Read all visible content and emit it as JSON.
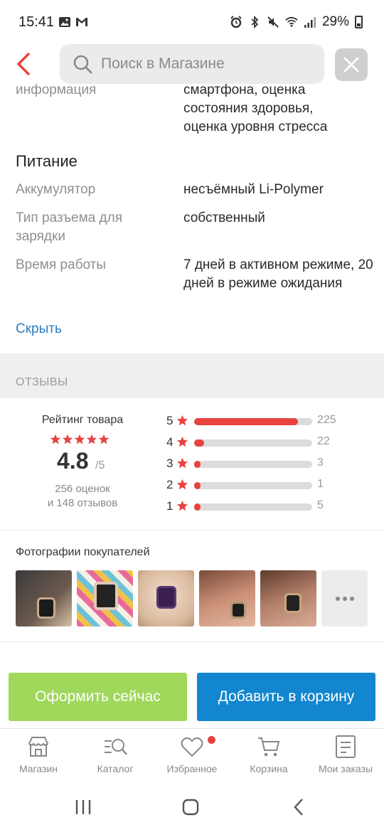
{
  "status_bar": {
    "time": "15:41",
    "battery": "29%",
    "left_icons": [
      "image-icon",
      "gmail-icon"
    ],
    "right_icons": [
      "alarm-icon",
      "bluetooth-icon",
      "mute-icon",
      "wifi-icon",
      "signal-icon",
      "battery-icon"
    ]
  },
  "search": {
    "placeholder": "Поиск в Магазине"
  },
  "specs": {
    "partial_label": "информация",
    "partial_value_lines": [
      "смартфона, оценка",
      "состояния здоровья,",
      "оценка уровня стресса"
    ],
    "section_title": "Питание",
    "rows": [
      {
        "label": "Аккумулятор",
        "value": "несъёмный Li-Polymer"
      },
      {
        "label": "Тип разъема для зарядки",
        "value": "собственный"
      },
      {
        "label": "Время работы",
        "value": "7 дней в активном режиме, 20 дней в режиме ожидания"
      }
    ],
    "hide_link": "Скрыть"
  },
  "reviews": {
    "section_label": "ОТЗЫВЫ",
    "rating_title": "Рейтинг товара",
    "score": "4.8",
    "score_max": "/5",
    "ratings_count": "256 оценок",
    "reviews_count": "и 148 отзывов",
    "distribution": [
      {
        "stars": "5",
        "count": "225",
        "fraction": 0.879
      },
      {
        "stars": "4",
        "count": "22",
        "fraction": 0.086
      },
      {
        "stars": "3",
        "count": "3",
        "fraction": 0.012
      },
      {
        "stars": "2",
        "count": "1",
        "fraction": 0.004
      },
      {
        "stars": "1",
        "count": "5",
        "fraction": 0.02
      }
    ],
    "accent_color": "#e8433f"
  },
  "photos": {
    "title": "Фотографии покупателей",
    "more_icon": "more-horizontal-icon"
  },
  "actions": {
    "order_label": "Оформить сейчас",
    "cart_label": "Добавить в корзину",
    "order_color": "#9fd85a",
    "cart_color": "#1286cf"
  },
  "bottom_nav": {
    "items": [
      {
        "label": "Магазин",
        "icon": "store-icon"
      },
      {
        "label": "Каталог",
        "icon": "catalog-search-icon"
      },
      {
        "label": "Избранное",
        "icon": "heart-icon"
      },
      {
        "label": "Корзина",
        "icon": "cart-icon"
      },
      {
        "label": "Мои заказы",
        "icon": "orders-icon"
      }
    ]
  }
}
